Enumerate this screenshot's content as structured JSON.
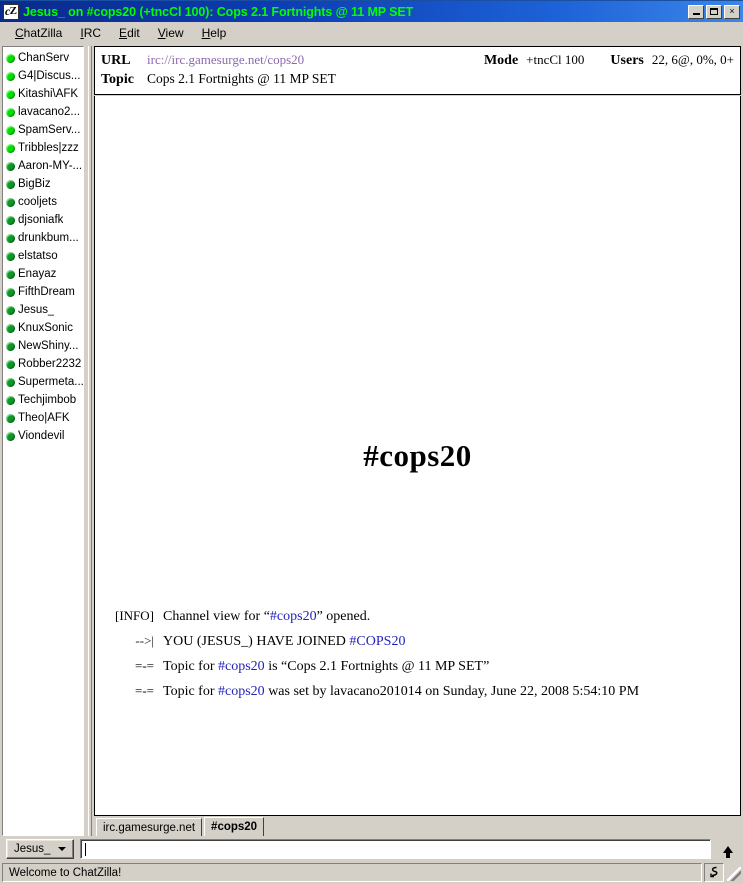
{
  "window": {
    "title": "Jesus_ on #cops20 (+tncCl 100): Cops 2.1 Fortnights @ 11 MP SET",
    "icon_left": "c",
    "icon_right": "Z",
    "minimize_label": "",
    "maximize_label": "",
    "close_label": "×",
    "titlebar_text_color": "#00ff00"
  },
  "menubar": {
    "items": [
      {
        "accel": "C",
        "rest": "hatZilla"
      },
      {
        "accel": "I",
        "rest": "RC"
      },
      {
        "accel": "E",
        "rest": "dit"
      },
      {
        "accel": "V",
        "rest": "iew"
      },
      {
        "accel": "H",
        "rest": "elp"
      }
    ]
  },
  "userlist": {
    "users": [
      {
        "nick": "ChanServ",
        "status": "op"
      },
      {
        "nick": "G4|Discus...",
        "status": "op"
      },
      {
        "nick": "Kitashi\\AFK",
        "status": "op"
      },
      {
        "nick": "lavacano2...",
        "status": "op"
      },
      {
        "nick": "SpamServ...",
        "status": "op"
      },
      {
        "nick": "Tribbles|zzz",
        "status": "op"
      },
      {
        "nick": "Aaron-MY-...",
        "status": "normal"
      },
      {
        "nick": "BigBiz",
        "status": "normal"
      },
      {
        "nick": "cooljets",
        "status": "normal"
      },
      {
        "nick": "djsoniafk",
        "status": "normal"
      },
      {
        "nick": "drunkbum...",
        "status": "normal"
      },
      {
        "nick": "elstatso",
        "status": "normal"
      },
      {
        "nick": "Enayaz",
        "status": "normal"
      },
      {
        "nick": "FifthDream",
        "status": "normal"
      },
      {
        "nick": "Jesus_",
        "status": "normal"
      },
      {
        "nick": "KnuxSonic",
        "status": "normal"
      },
      {
        "nick": "NewShiny...",
        "status": "normal"
      },
      {
        "nick": "Robber2232",
        "status": "normal"
      },
      {
        "nick": "Supermeta...",
        "status": "normal"
      },
      {
        "nick": "Techjimbob",
        "status": "normal"
      },
      {
        "nick": "Theo|AFK",
        "status": "normal"
      },
      {
        "nick": "Viondevil",
        "status": "normal"
      }
    ]
  },
  "header": {
    "url_label": "URL",
    "url_value": "irc://irc.gamesurge.net/cops20",
    "url_color": "#8b69b0",
    "mode_label": "Mode",
    "mode_value": "+tncCl 100",
    "users_label": "Users",
    "users_value": "22, 6@, 0%, 0+",
    "topic_label": "Topic",
    "topic_value": "Cops 2.1 Fortnights @ 11 MP SET"
  },
  "chat": {
    "watermark": "#cops20",
    "link_color": "#2222bb",
    "lines": [
      {
        "prefix": "[INFO]",
        "segments": [
          {
            "text": "Channel view for “",
            "kind": "plain"
          },
          {
            "text": "#cops20",
            "kind": "link"
          },
          {
            "text": "” opened.",
            "kind": "plain"
          }
        ]
      },
      {
        "prefix": "-->|",
        "segments": [
          {
            "text": "YOU (JESUS_) HAVE JOINED ",
            "kind": "smallcaps"
          },
          {
            "text": "#COPS20",
            "kind": "link-smallcaps"
          }
        ]
      },
      {
        "prefix": "=-=",
        "segments": [
          {
            "text": "Topic for ",
            "kind": "plain"
          },
          {
            "text": "#cops20",
            "kind": "link"
          },
          {
            "text": " is “Cops 2.1 Fortnights @ 11 MP SET”",
            "kind": "plain"
          }
        ]
      },
      {
        "prefix": "=-=",
        "segments": [
          {
            "text": "Topic for ",
            "kind": "plain"
          },
          {
            "text": "#cops20",
            "kind": "link"
          },
          {
            "text": " was set by lavacano201014 on Sunday, June 22, 2008 5:54:10 PM",
            "kind": "plain"
          }
        ]
      }
    ]
  },
  "tabs": [
    {
      "label": "irc.gamesurge.net",
      "active": false
    },
    {
      "label": "#cops20",
      "active": true
    }
  ],
  "input": {
    "nick_button_label": "Jesus_",
    "message_value": "",
    "message_placeholder": "",
    "send_arrow_icon": "up-arrow-icon"
  },
  "statusbar": {
    "message": "Welcome to ChatZilla!",
    "icon": "activity-icon",
    "resize_grip": "resize-grip-icon"
  }
}
